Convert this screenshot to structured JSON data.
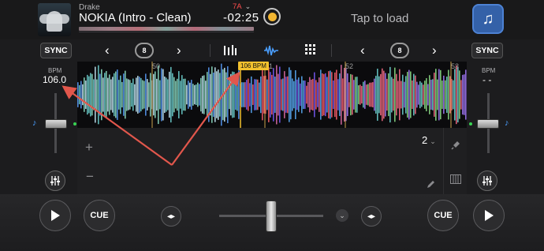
{
  "deck_a": {
    "artist": "Drake",
    "title": "NOKIA (Intro - Clean)",
    "key": "7A",
    "time_remaining": "-02:25",
    "bpm_label": "BPM",
    "bpm_value": "106.0",
    "sync_label": "SYNC",
    "loop_size": "8",
    "cue_label": "CUE"
  },
  "deck_b": {
    "placeholder": "Tap to load",
    "bpm_label": "BPM",
    "bpm_value": "- -",
    "sync_label": "SYNC",
    "loop_size": "8",
    "cue_label": "CUE"
  },
  "waveform": {
    "bpm_flag": "106 BPM",
    "beat_markers": [
      "50",
      "51",
      "52",
      "53"
    ]
  },
  "pads": {
    "bank_number": "2",
    "plus": "+",
    "minus": "−"
  },
  "icons": {
    "deck_a_prev": "chevron-left-icon",
    "deck_a_next": "chevron-right-icon",
    "loop": "loop-icon",
    "eq": "eq-icon",
    "waveform": "waveform-icon",
    "grid": "grid-icon",
    "music_library": "music-note-icon",
    "mixer": "mixer-sliders-icon",
    "play": "play-icon",
    "nudge": "nudge-icon",
    "mic": "mic-icon",
    "pencil": "pencil-icon",
    "keyboard": "keyboard-icon"
  },
  "colors": {
    "accent_blue": "#3461a8",
    "bpm_flag": "#f2c12e",
    "key_red": "#ff4d4d",
    "annotation_arrow": "#e2574c"
  }
}
